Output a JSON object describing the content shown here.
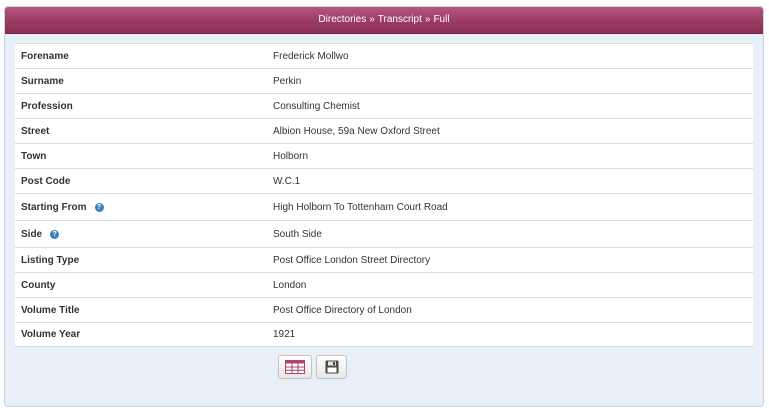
{
  "breadcrumb": {
    "items": [
      "Directories",
      "Transcript",
      "Full"
    ],
    "separator": "»"
  },
  "record": {
    "rows": [
      {
        "label": "Forename",
        "value": "Frederick Mollwo"
      },
      {
        "label": "Surname",
        "value": "Perkin"
      },
      {
        "label": "Profession",
        "value": "Consulting Chemist"
      },
      {
        "label": "Street",
        "value": "Albion House, 59a New Oxford Street"
      },
      {
        "label": "Town",
        "value": "Holborn"
      },
      {
        "label": "Post Code",
        "value": "W.C.1"
      },
      {
        "label": "Starting From",
        "value": "High Holborn To Tottenham Court Road",
        "help": "?"
      },
      {
        "label": "Side",
        "value": "South Side",
        "help": "?"
      },
      {
        "label": "Listing Type",
        "value": "Post Office London Street Directory"
      },
      {
        "label": "County",
        "value": "London"
      },
      {
        "label": "Volume Title",
        "value": "Post Office Directory of London"
      },
      {
        "label": "Volume Year",
        "value": "1921"
      }
    ]
  },
  "actions": {
    "buttons": [
      {
        "icon": "spreadsheet-icon"
      },
      {
        "icon": "save-icon"
      }
    ]
  },
  "colors": {
    "header": "#9b3a63",
    "panel_background": "#e8eff7",
    "help_icon": "#3f7ebf"
  }
}
